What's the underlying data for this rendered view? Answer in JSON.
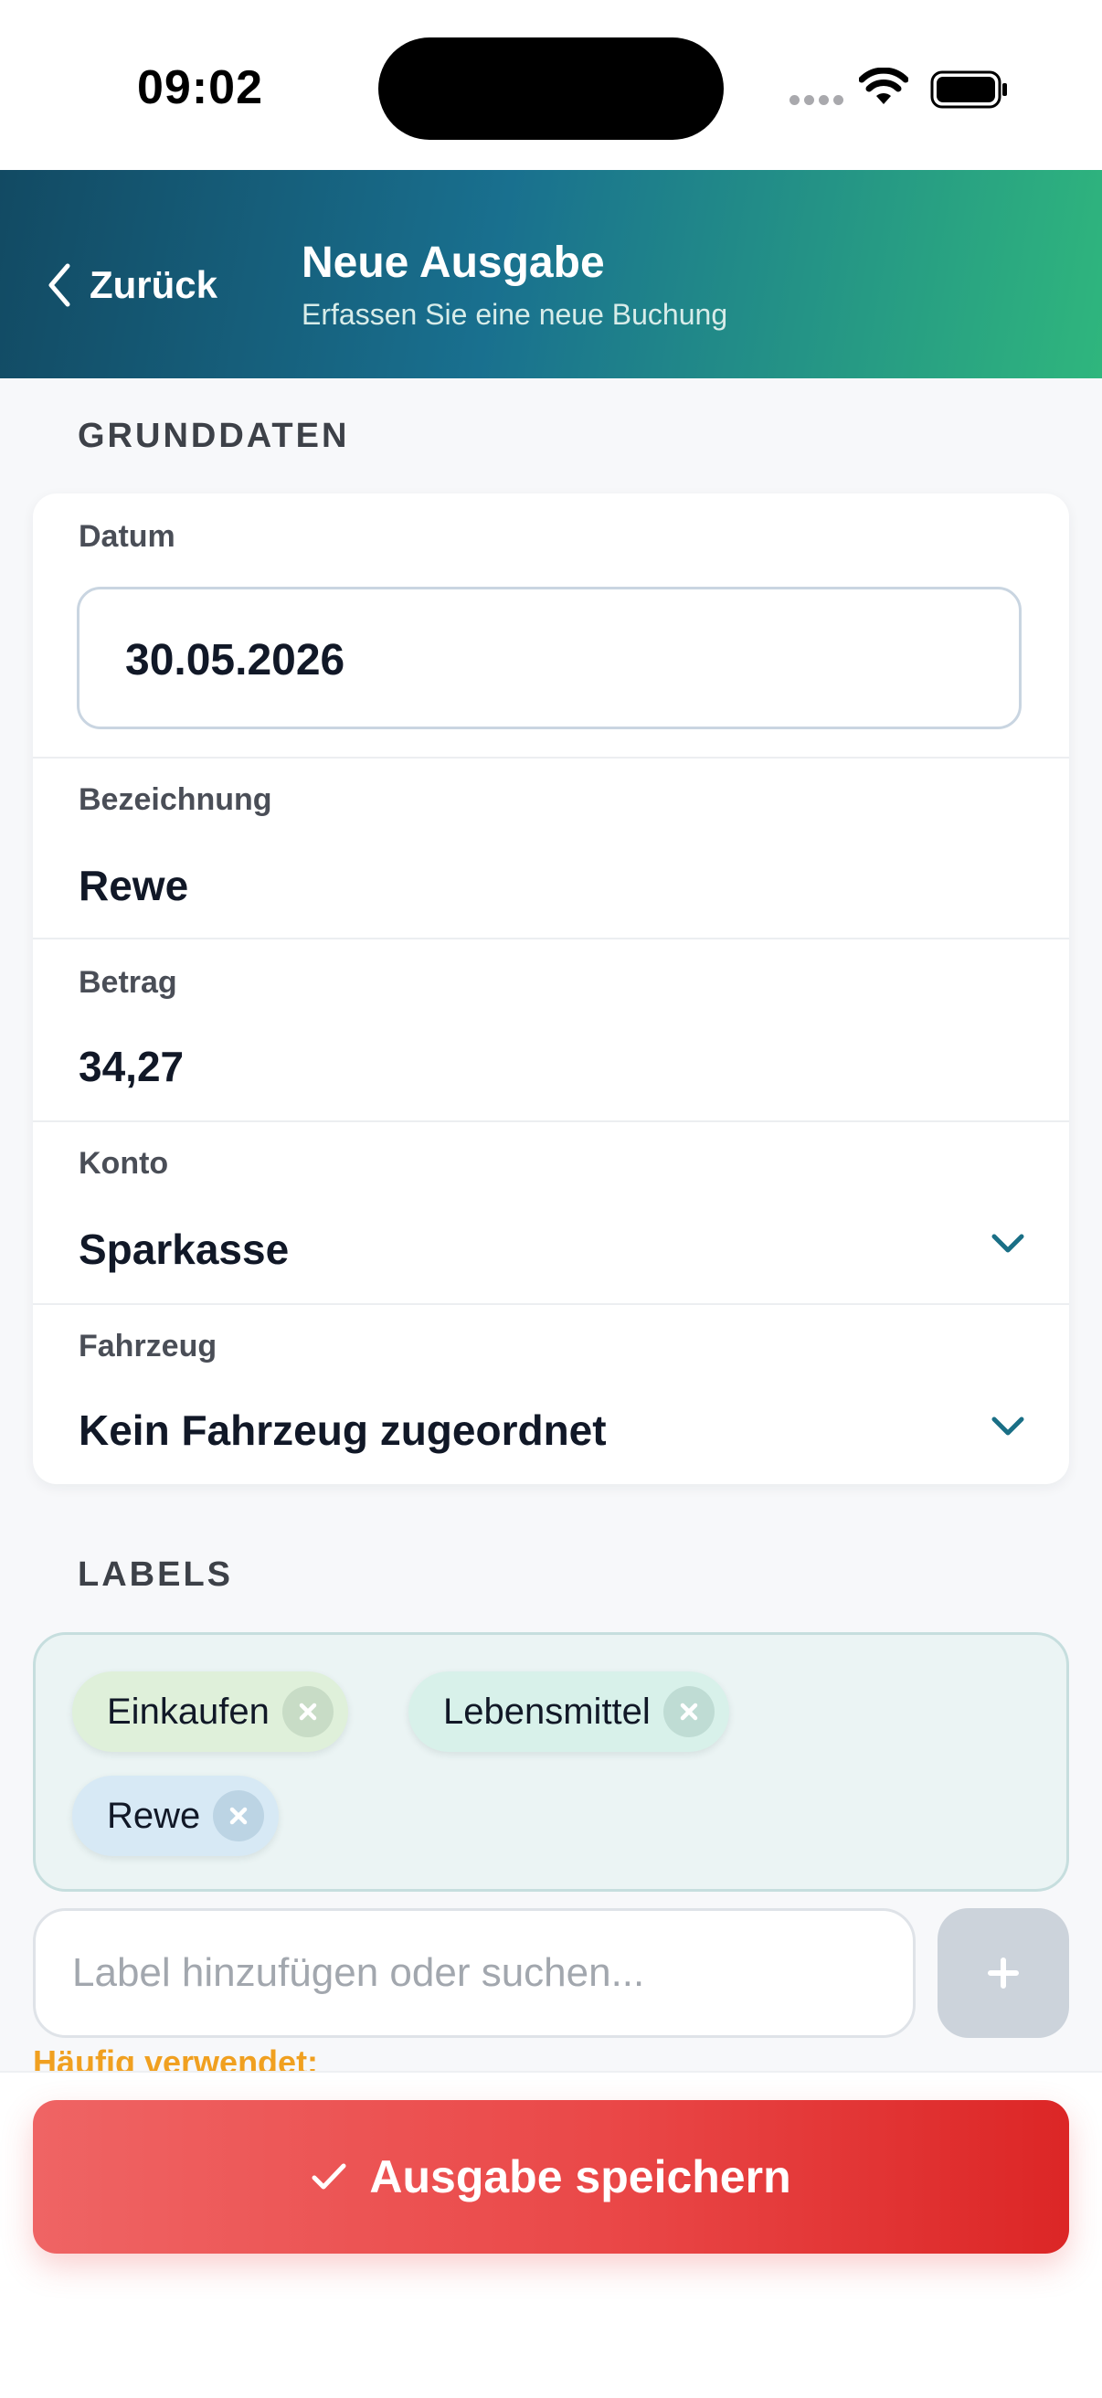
{
  "status_bar": {
    "time": "09:02"
  },
  "header": {
    "back_label": "Zurück",
    "title": "Neue Ausgabe",
    "subtitle": "Erfassen Sie eine neue Buchung"
  },
  "grunddaten": {
    "section_title": "GRUNDDATEN",
    "date": {
      "label": "Datum",
      "value": "30.05.2026"
    },
    "bezeichnung": {
      "label": "Bezeichnung",
      "value": "Rewe"
    },
    "betrag": {
      "label": "Betrag",
      "value": "34,27"
    },
    "konto": {
      "label": "Konto",
      "value": "Sparkasse"
    },
    "fahrzeug": {
      "label": "Fahrzeug",
      "value": "Kein Fahrzeug zugeordnet"
    }
  },
  "labels": {
    "section_title": "LABELS",
    "chips": [
      {
        "text": "Einkaufen",
        "color": "#dff0da"
      },
      {
        "text": "Lebensmittel",
        "color": "#d8f1ea"
      },
      {
        "text": "Rewe",
        "color": "#d7e9f5"
      }
    ],
    "input_placeholder": "Label hinzufügen oder suchen...",
    "add_icon": "+",
    "frequently_used": "Häufig verwendet:"
  },
  "actions": {
    "save_label": "Ausgabe speichern"
  },
  "colors": {
    "accent": "#1a6f86",
    "danger": "#e54848",
    "warning": "#f0a020"
  }
}
